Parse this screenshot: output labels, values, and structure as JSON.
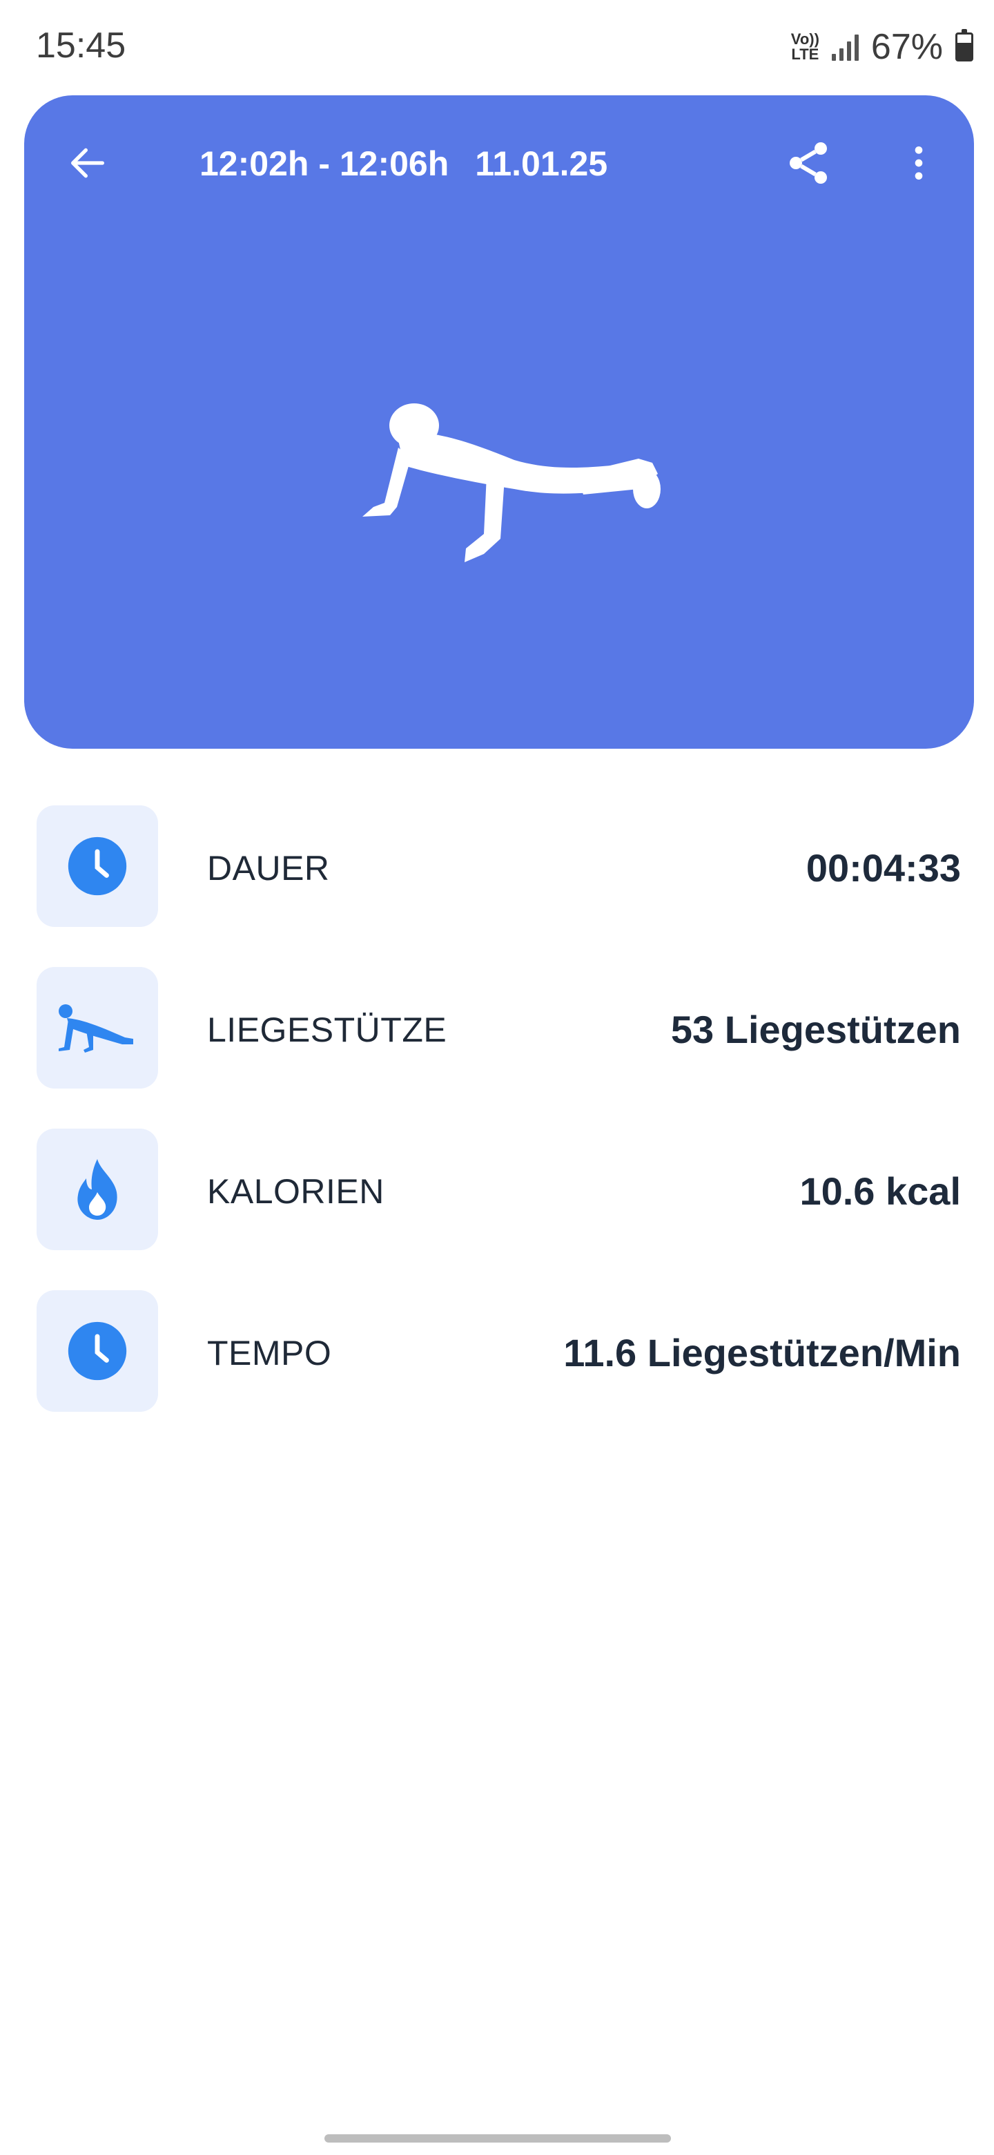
{
  "status_bar": {
    "time": "15:45",
    "volte_top": "Vo))",
    "volte_bottom": "LTE",
    "battery": "67%",
    "battery_level": 0.67
  },
  "header": {
    "time_range": "12:02h - 12:06h",
    "date": "11.01.25",
    "back_icon": "arrow-left-icon",
    "share_icon": "share-icon",
    "more_icon": "more-vertical-icon"
  },
  "hero": {
    "background_color": "#5878e6",
    "figure": "pushup-silhouette"
  },
  "stats": [
    {
      "icon": "clock-icon",
      "label": "DAUER",
      "value": "00:04:33"
    },
    {
      "icon": "pushup-icon",
      "label": "LIEGESTÜTZE",
      "value": "53 Liegestützen"
    },
    {
      "icon": "flame-icon",
      "label": "KALORIEN",
      "value": "10.6 kcal"
    },
    {
      "icon": "clock-icon",
      "label": "TEMPO",
      "value": "11.6 Liegestützen/Min"
    }
  ],
  "colors": {
    "accent": "#2f86f0",
    "icon_bg": "#eaf0fd",
    "text": "#1f2937"
  }
}
